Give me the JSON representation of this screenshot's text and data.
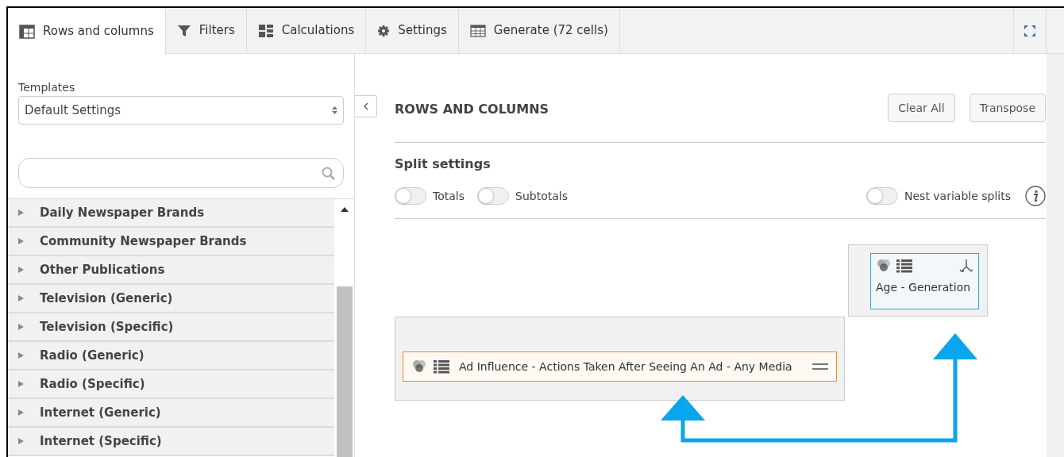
{
  "tabs": [
    {
      "label": "Rows and columns",
      "kind": "table",
      "selected": true
    },
    {
      "label": "Filters",
      "kind": "filter",
      "selected": false
    },
    {
      "label": "Calculations",
      "kind": "calc",
      "selected": false
    },
    {
      "label": "Settings",
      "kind": "gear",
      "selected": false
    },
    {
      "label": "Generate (72 cells)",
      "kind": "grid",
      "selected": false
    }
  ],
  "sidebar": {
    "templates_label": "Templates",
    "template_value": "Default Settings",
    "items": [
      {
        "label": "Daily Newspaper Brands",
        "expanded": false
      },
      {
        "label": "Community Newspaper Brands",
        "expanded": false
      },
      {
        "label": "Other Publications",
        "expanded": false
      },
      {
        "label": "Television (Generic)",
        "expanded": false
      },
      {
        "label": "Television (Specific)",
        "expanded": false
      },
      {
        "label": "Radio (Generic)",
        "expanded": false
      },
      {
        "label": "Radio (Specific)",
        "expanded": false
      },
      {
        "label": "Internet (Generic)",
        "expanded": false
      },
      {
        "label": "Internet (Specific)",
        "expanded": false
      }
    ]
  },
  "main": {
    "title": "ROWS AND COLUMNS",
    "buttons": [
      "Clear All",
      "Transpose"
    ],
    "split_title": "Split settings",
    "toggles": [
      {
        "label": "Totals",
        "on": false
      },
      {
        "label": "Subtotals",
        "on": false
      }
    ],
    "nest_toggle": {
      "label": "Nest variable splits",
      "on": false
    },
    "columns": [
      {
        "label": "Age - Generation"
      }
    ],
    "rows": [
      {
        "label": "Ad Influence - Actions Taken After Seeing An Ad - Any Media"
      }
    ]
  }
}
